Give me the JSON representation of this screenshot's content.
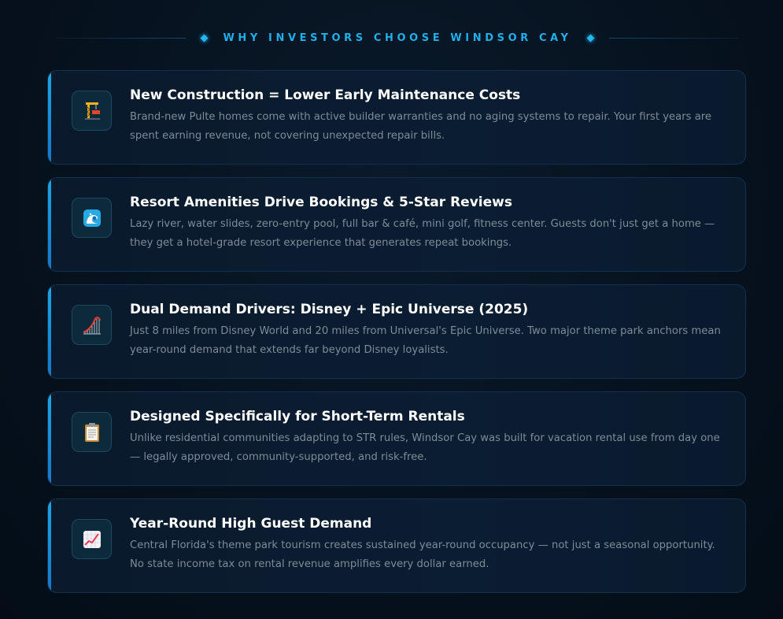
{
  "header": {
    "title": "WHY INVESTORS CHOOSE WINDSOR CAY"
  },
  "colors": {
    "accent": "#1fb0ea",
    "card_bg": "#0b1d31",
    "text_primary": "#ffffff",
    "text_secondary": "#7e8b99"
  },
  "cards": [
    {
      "icon": "construction-crane-icon",
      "title": "New Construction = Lower Early Maintenance Costs",
      "description": "Brand-new Pulte homes come with active builder warranties and no aging systems to repair. Your first years are spent earning revenue, not covering unexpected repair bills."
    },
    {
      "icon": "wave-icon",
      "title": "Resort Amenities Drive Bookings & 5-Star Reviews",
      "description": "Lazy river, water slides, zero-entry pool, full bar & café, mini golf, fitness center. Guests don't just get a home — they get a hotel-grade resort experience that generates repeat bookings."
    },
    {
      "icon": "roller-coaster-icon",
      "title": "Dual Demand Drivers: Disney + Epic Universe (2025)",
      "description": "Just 8 miles from Disney World and 20 miles from Universal's Epic Universe. Two major theme park anchors mean year-round demand that extends far beyond Disney loyalists."
    },
    {
      "icon": "clipboard-icon",
      "title": "Designed Specifically for Short-Term Rentals",
      "description": "Unlike residential communities adapting to STR rules, Windsor Cay was built for vacation rental use from day one — legally approved, community-supported, and risk-free."
    },
    {
      "icon": "chart-increasing-icon",
      "title": "Year-Round High Guest Demand",
      "description": "Central Florida's theme park tourism creates sustained year-round occupancy — not just a seasonal opportunity. No state income tax on rental revenue amplifies every dollar earned."
    }
  ]
}
